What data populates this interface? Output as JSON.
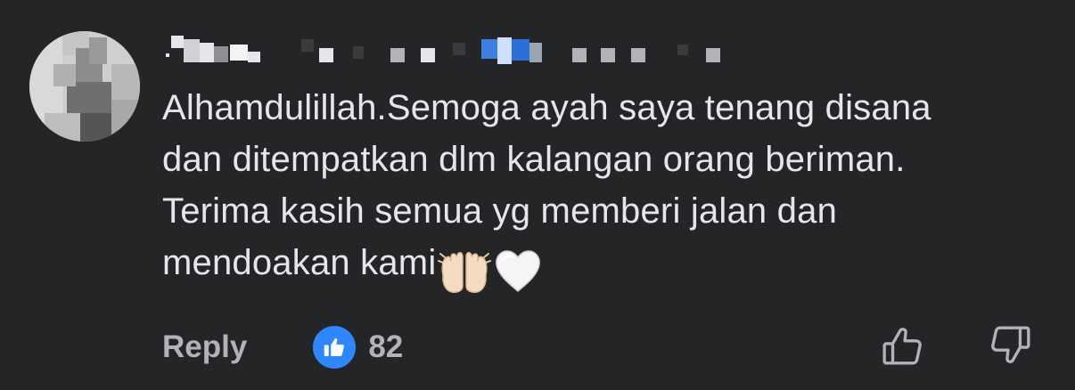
{
  "comment": {
    "text": "Alhamdulillah.Semoga ayah saya tenang disana\ndan ditempatkan dlm kalangan orang beriman.\nTerima kasih semua yg memberi jalan dan\nmendoakan kami",
    "emojis": [
      "raising-hands-emoji",
      "white-heart-emoji"
    ]
  },
  "actions": {
    "reply_label": "Reply",
    "reaction_icon": "like-icon",
    "reaction_count": "82",
    "upvote_icon": "thumbs-up-outline-icon",
    "downvote_icon": "thumbs-down-outline-icon"
  },
  "colors": {
    "background": "#242526",
    "text": "#e4e6eb",
    "secondary_text": "#b0b3b8",
    "like_blue": "#2d88ff"
  }
}
